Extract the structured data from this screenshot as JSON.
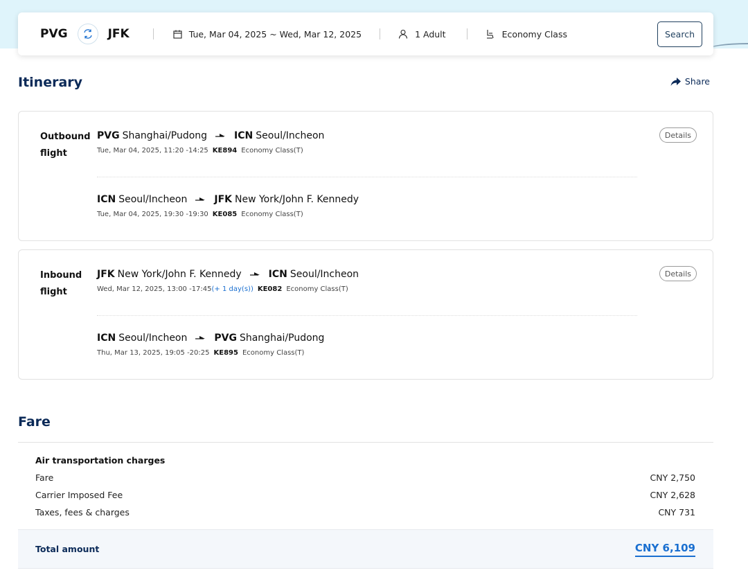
{
  "search": {
    "origin": "PVG",
    "destination": "JFK",
    "dates": "Tue, Mar 04, 2025 ~ Wed, Mar 12, 2025",
    "passengers": "1 Adult",
    "cabin": "Economy Class",
    "search_label": "Search"
  },
  "itinerary": {
    "title": "Itinerary",
    "share_label": "Share",
    "outbound": {
      "label_line1": "Outbound",
      "label_line2": "flight",
      "details_label": "Details",
      "segments": [
        {
          "from_code": "PVG",
          "from_city": "Shanghai/Pudong",
          "to_code": "ICN",
          "to_city": "Seoul/Incheon",
          "info": "Tue, Mar 04, 2025, 11:20 -14:25",
          "plus_day": "",
          "flight": "KE894",
          "cabin": "Economy Class(T)"
        },
        {
          "from_code": "ICN",
          "from_city": "Seoul/Incheon",
          "to_code": "JFK",
          "to_city": "New York/John F. Kennedy",
          "info": "Tue, Mar 04, 2025, 19:30 -19:30",
          "plus_day": "",
          "flight": "KE085",
          "cabin": "Economy Class(T)"
        }
      ]
    },
    "inbound": {
      "label_line1": "Inbound",
      "label_line2": "flight",
      "details_label": "Details",
      "segments": [
        {
          "from_code": "JFK",
          "from_city": "New York/John F. Kennedy",
          "to_code": "ICN",
          "to_city": "Seoul/Incheon",
          "info": "Wed, Mar 12, 2025, 13:00 -17:45",
          "plus_day": "(+ 1 day(s))",
          "flight": "KE082",
          "cabin": "Economy Class(T)"
        },
        {
          "from_code": "ICN",
          "from_city": "Seoul/Incheon",
          "to_code": "PVG",
          "to_city": "Shanghai/Pudong",
          "info": "Thu, Mar 13, 2025, 19:05 -20:25",
          "plus_day": "",
          "flight": "KE895",
          "cabin": "Economy Class(T)"
        }
      ]
    }
  },
  "fare": {
    "title": "Fare",
    "group_heading": "Air transportation charges",
    "rows": [
      {
        "label": "Fare",
        "value": "CNY 2,750"
      },
      {
        "label": "Carrier Imposed Fee",
        "value": "CNY 2,628"
      },
      {
        "label": "Taxes, fees & charges",
        "value": "CNY 731"
      }
    ],
    "total_label": "Total amount",
    "total_value": "CNY 6,109"
  },
  "colors": {
    "brand_navy": "#0b2a58",
    "link_blue": "#1a6fd0",
    "header_band": "#dff4fb"
  },
  "icons": [
    "swap-icon",
    "calendar-icon",
    "person-icon",
    "seat-icon",
    "share-arrow-icon",
    "flight-arrow-icon"
  ]
}
